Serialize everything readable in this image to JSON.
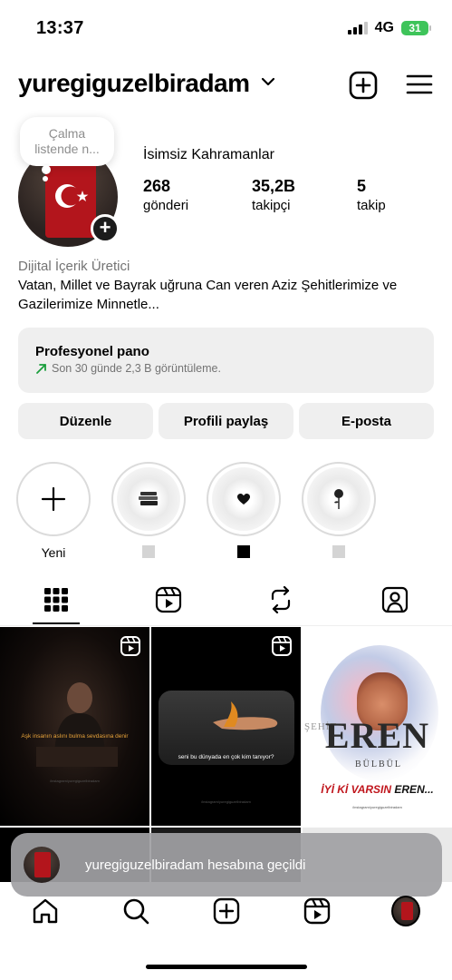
{
  "status_bar": {
    "time": "13:37",
    "network": "4G",
    "battery": "31"
  },
  "header": {
    "username": "yuregiguzelbiradam"
  },
  "profile": {
    "note": "Çalma listende n...",
    "display_name": "İsimsiz Kahramanlar",
    "stats": [
      {
        "value": "268",
        "label": "gönderi"
      },
      {
        "value": "35,2B",
        "label": "takipçi"
      },
      {
        "value": "5",
        "label": "takip"
      }
    ],
    "category": "Dijital İçerik Üretici",
    "bio": "Vatan, Millet ve Bayrak uğruna Can veren Aziz Şehitlerimize ve Gazilerimize Minnetle..."
  },
  "dashboard": {
    "title": "Profesyonel pano",
    "subtitle": "Son 30 günde 2,3 B görüntüleme."
  },
  "buttons": {
    "edit": "Düzenle",
    "share": "Profili paylaş",
    "email": "E-posta"
  },
  "highlights": [
    {
      "label": "Yeni",
      "icon": "plus-icon"
    },
    {
      "label_color": "#d4d4d4",
      "icon": "books-icon"
    },
    {
      "label_color": "#000000",
      "icon": "heart-icon"
    },
    {
      "label_color": "#d4d4d4",
      "icon": "rose-icon"
    }
  ],
  "tabs": [
    "grid-icon",
    "reels-icon",
    "reposts-icon",
    "tagged-icon"
  ],
  "posts": [
    {
      "caption": "Aşk insanın aslını bulma sevdasına denir",
      "watermark": "/instagram/yuregiguzelbiradam",
      "reel": true
    },
    {
      "caption": "seni bu dünyada en çok kim tanıyor?",
      "watermark": "/instagram/yuregiguzelbiradam",
      "reel": true
    },
    {
      "sehit": "ŞEHİT",
      "name": "EREN",
      "surname": "BÜLBÜL",
      "banner_lead": "İYİ Kİ VARSIN",
      "banner_name": "EREN...",
      "watermark": "/instagram/yuregiguzelbiradam",
      "reel": false
    }
  ],
  "toast": {
    "message": "yuregiguzelbiradam hesabına geçildi"
  },
  "bottom_nav": [
    "home-icon",
    "search-icon",
    "create-icon",
    "reels-icon",
    "profile-avatar"
  ],
  "colors": {
    "accent_green": "#1a9e3c",
    "flag_red": "#b3151c",
    "button_bg": "#efefef"
  }
}
